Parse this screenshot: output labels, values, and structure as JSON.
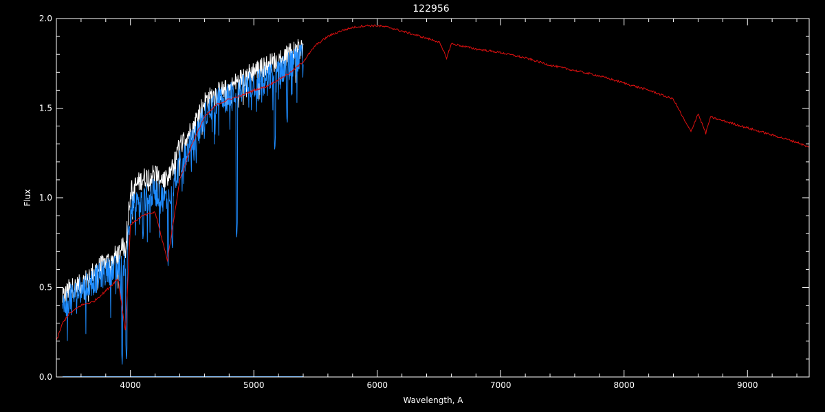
{
  "chart_data": {
    "type": "line",
    "title": "122956",
    "xlabel": "Wavelength, A",
    "ylabel": "Flux",
    "xlim": [
      3400,
      9500
    ],
    "ylim": [
      0,
      2.0
    ],
    "x_ticks": [
      4000,
      5000,
      6000,
      7000,
      8000,
      9000
    ],
    "x_tick_labels": [
      "4000",
      "5000",
      "6000",
      "7000",
      "8000",
      "9000"
    ],
    "y_ticks": [
      0,
      0.5,
      1.0,
      1.5,
      2.0
    ],
    "y_tick_labels": [
      "0.0",
      "0.5",
      "1.0",
      "1.5",
      "2.0"
    ],
    "grid": false,
    "colors": {
      "background": "#000000",
      "axes": "#ffffff",
      "observed_upper": "#ffffff",
      "observed": "#1e8cff",
      "model": "#e01010",
      "error": "#1e8cff"
    },
    "series": [
      {
        "color": "#ffffff",
        "style": "noisy",
        "noise": 0.06,
        "x": [
          3450,
          3500,
          3600,
          3700,
          3800,
          3900,
          3960,
          4000,
          4100,
          4200,
          4300,
          4400,
          4500,
          4600,
          4700,
          4800,
          4900,
          5000,
          5100,
          5200,
          5300,
          5400
        ],
        "y": [
          0.45,
          0.5,
          0.53,
          0.6,
          0.65,
          0.7,
          0.75,
          1.05,
          1.12,
          1.15,
          1.1,
          1.3,
          1.4,
          1.55,
          1.6,
          1.62,
          1.68,
          1.72,
          1.75,
          1.78,
          1.82,
          1.85
        ]
      },
      {
        "color": "#1e8cff",
        "style": "noisy",
        "noise": 0.08,
        "x": [
          3450,
          3500,
          3600,
          3700,
          3800,
          3900,
          3960,
          4000,
          4100,
          4200,
          4300,
          4400,
          4500,
          4600,
          4700,
          4800,
          4900,
          5000,
          5100,
          5200,
          5300,
          5400
        ],
        "y": [
          0.4,
          0.45,
          0.5,
          0.55,
          0.6,
          0.62,
          0.65,
          0.95,
          1.0,
          1.05,
          1.0,
          1.2,
          1.32,
          1.47,
          1.55,
          1.58,
          1.62,
          1.65,
          1.68,
          1.72,
          1.76,
          1.8
        ],
        "absorption": [
          {
            "x": 3933,
            "y": 0.07
          },
          {
            "x": 3968,
            "y": 0.08
          },
          {
            "x": 4102,
            "y": 0.75
          },
          {
            "x": 4305,
            "y": 0.62
          },
          {
            "x": 4340,
            "y": 0.7
          },
          {
            "x": 4861,
            "y": 0.76
          },
          {
            "x": 5170,
            "y": 1.25
          },
          {
            "x": 5270,
            "y": 1.4
          }
        ]
      },
      {
        "color": "#e01010",
        "style": "smooth",
        "x": [
          3400,
          3450,
          3500,
          3600,
          3700,
          3800,
          3900,
          3960,
          4000,
          4100,
          4200,
          4300,
          4400,
          4500,
          4600,
          4700,
          4800,
          4900,
          5000,
          5100,
          5200,
          5300,
          5400,
          5500,
          5600,
          5700,
          5800,
          5900,
          6000,
          6100,
          6200,
          6300,
          6400,
          6500,
          6563,
          6600,
          6800,
          7000,
          7200,
          7400,
          7600,
          7800,
          8000,
          8200,
          8400,
          8498,
          8542,
          8600,
          8662,
          8700,
          8800,
          9000,
          9200,
          9400,
          9500
        ],
        "y": [
          0.2,
          0.3,
          0.35,
          0.4,
          0.42,
          0.48,
          0.55,
          0.25,
          0.85,
          0.9,
          0.92,
          0.65,
          1.1,
          1.3,
          1.45,
          1.52,
          1.55,
          1.57,
          1.6,
          1.62,
          1.66,
          1.7,
          1.76,
          1.85,
          1.9,
          1.93,
          1.95,
          1.96,
          1.96,
          1.95,
          1.93,
          1.91,
          1.89,
          1.87,
          1.78,
          1.86,
          1.83,
          1.81,
          1.78,
          1.74,
          1.71,
          1.68,
          1.64,
          1.6,
          1.55,
          1.42,
          1.37,
          1.47,
          1.36,
          1.45,
          1.43,
          1.39,
          1.35,
          1.31,
          1.28
        ]
      },
      {
        "color": "#1e8cff",
        "style": "flat",
        "x": [
          3450,
          5400
        ],
        "y": [
          0.0,
          0.0
        ]
      }
    ]
  }
}
